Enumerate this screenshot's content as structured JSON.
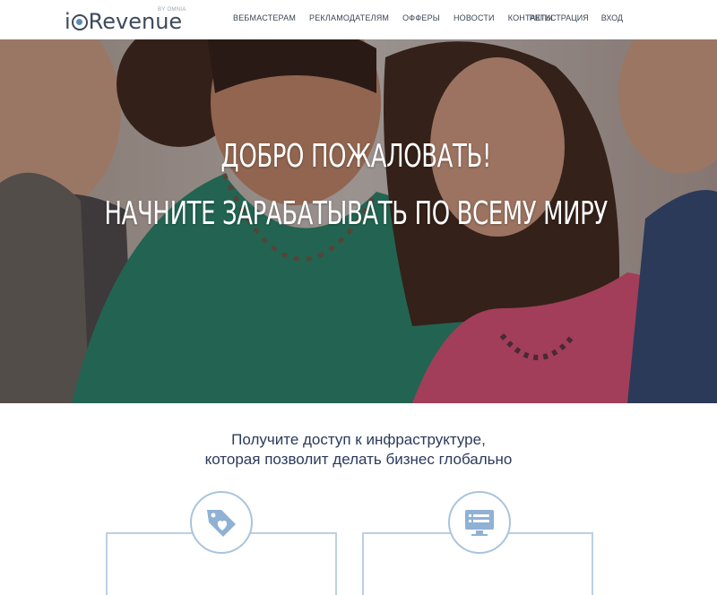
{
  "header": {
    "logo_i": "i",
    "logo_revenue": "Revenue",
    "logo_by": "BY OMNIA",
    "nav": [
      "ВЕБМАСТЕРАМ",
      "РЕКЛАМОДАТЕЛЯМ",
      "ОФФЕРЫ",
      "НОВОСТИ",
      "КОНТАКТЫ"
    ],
    "register": "РЕГИСТРАЦИЯ",
    "login": "ВХОД"
  },
  "hero": {
    "title": "ДОБРО ПОЖАЛОВАТЬ!",
    "subtitle": "НАЧНИТЕ ЗАРАБАТЫВАТЬ ПО ВСЕМУ МИРУ"
  },
  "intro": {
    "line1": "Получите доступ к инфраструктуре,",
    "line2": "которая позволит делать бизнес глобально"
  },
  "features": [
    {
      "icon": "tag-heart-icon"
    },
    {
      "icon": "monitor-list-icon"
    }
  ],
  "colors": {
    "brand": "#3d4a5c",
    "accent": "#5b8ab8",
    "card_border": "#bcd0e4",
    "intro_text": "#2b3a5c"
  }
}
